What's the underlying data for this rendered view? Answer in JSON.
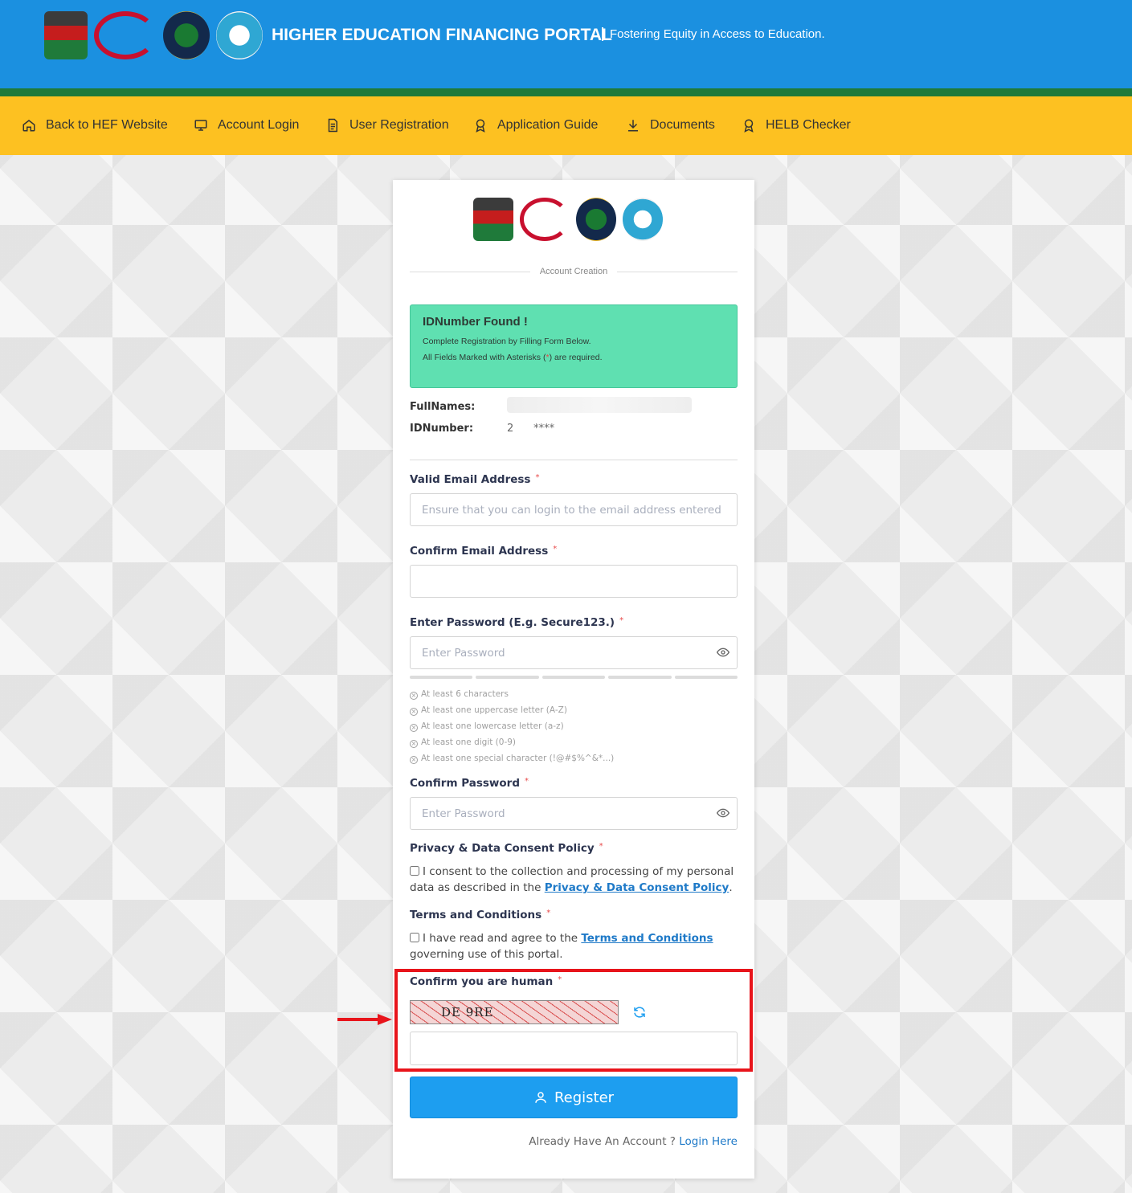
{
  "header": {
    "title": "HIGHER EDUCATION FINANCING PORTAL",
    "tagline": "Fostering Equity in Access to Education.",
    "logos": [
      "kenya-coat-of-arms-logo",
      "ministry-of-education-logo",
      "helb-logo",
      "universities-fund-logo"
    ]
  },
  "nav": {
    "items": [
      {
        "label": "Back to HEF Website",
        "icon": "home-icon"
      },
      {
        "label": "Account Login",
        "icon": "monitor-icon"
      },
      {
        "label": "User Registration",
        "icon": "document-icon"
      },
      {
        "label": "Application Guide",
        "icon": "award-icon"
      },
      {
        "label": "Documents",
        "icon": "download-icon"
      },
      {
        "label": "HELB Checker",
        "icon": "award-icon"
      }
    ]
  },
  "card": {
    "section_title": "Account Creation",
    "alert": {
      "title": "IDNumber Found !",
      "line1": "Complete Registration by Filling Form Below.",
      "line2_pre": "All Fields Marked with Asterisks (",
      "line2_star": "*",
      "line2_post": ") are required."
    },
    "info": {
      "fullnames_label": "FullNames:",
      "idnumber_label": "IDNumber:",
      "idnumber_value": "2      ****"
    },
    "email": {
      "label": "Valid Email Address",
      "placeholder": "Ensure that you can login to the email address entered here"
    },
    "confirm_email": {
      "label": "Confirm Email Address",
      "placeholder": ""
    },
    "password": {
      "label": "Enter Password (E.g. Secure123.)",
      "placeholder": "Enter Password"
    },
    "rules": [
      "At least 6 characters",
      "At least one uppercase letter (A-Z)",
      "At least one lowercase letter (a-z)",
      "At least one digit (0-9)",
      "At least one special character (!@#$%^&*...)"
    ],
    "confirm_password": {
      "label": "Confirm Password",
      "placeholder": "Enter Password"
    },
    "privacy": {
      "label": "Privacy & Data Consent Policy",
      "text_pre": "I consent to the collection and processing of my personal data as described in the ",
      "link": "Privacy & Data Consent Policy",
      "text_post": "."
    },
    "terms": {
      "label": "Terms and Conditions",
      "text_pre": "I have read and agree to the ",
      "link": "Terms and Conditions",
      "text_post": " governing use of this portal."
    },
    "captcha": {
      "label": "Confirm you are human",
      "image_text": "DE 9RE",
      "placeholder": ""
    },
    "required_mark": "*",
    "register_label": "Register",
    "already_text": "Already Have An Account ?",
    "login_link": "Login Here"
  }
}
